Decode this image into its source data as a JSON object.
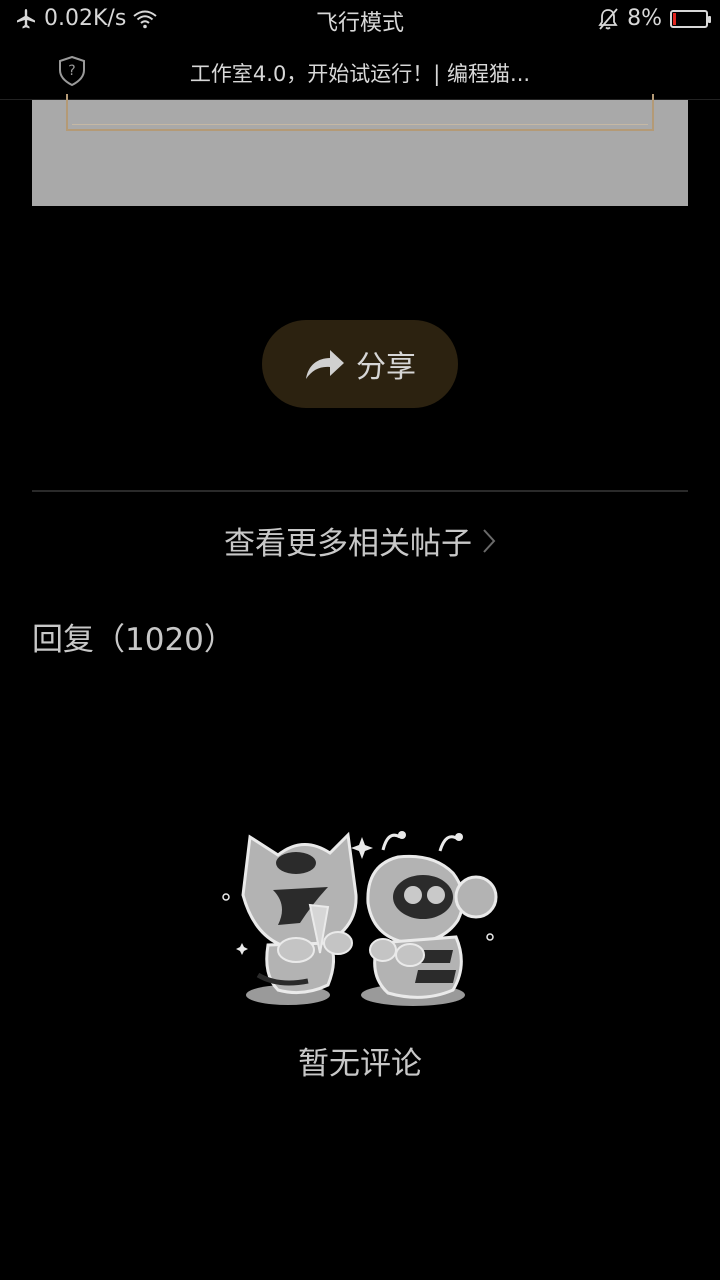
{
  "status_bar": {
    "network_speed": "0.02K/s",
    "mode_label": "飞行模式",
    "battery_level": "8%",
    "battery_fraction": 0.08,
    "icons": [
      "airplane-icon",
      "wifi-icon",
      "bell-muted-icon",
      "battery-icon"
    ]
  },
  "title_bar": {
    "title": "工作室4.0，开始试运行！| 编程猫...",
    "icon": "shield-question-icon"
  },
  "share": {
    "label": "分享",
    "icon": "share-arrow-icon",
    "bg_color": "#2c2210"
  },
  "more_posts": {
    "label": "查看更多相关帖子",
    "icon": "chevron-right-icon"
  },
  "replies": {
    "header": "回复（1020）"
  },
  "empty_state": {
    "text": "暂无评论",
    "illustration": "mascots-empty-illustration"
  }
}
